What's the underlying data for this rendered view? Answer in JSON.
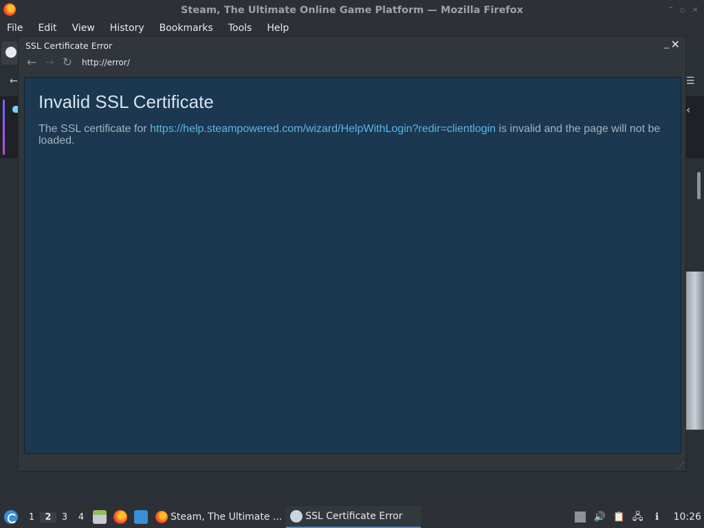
{
  "firefox": {
    "window_title": "Steam, The Ultimate Online Game Platform — Mozilla Firefox",
    "menu": [
      {
        "label": "File"
      },
      {
        "label": "Edit"
      },
      {
        "label": "View"
      },
      {
        "label": "History"
      },
      {
        "label": "Bookmarks"
      },
      {
        "label": "Tools"
      },
      {
        "label": "Help"
      }
    ],
    "window_controls": {
      "minimize": "‾",
      "maximize": "◇",
      "close": "✕"
    }
  },
  "dialog": {
    "title": "SSL Certificate Error",
    "minimize": "_",
    "close": "✕",
    "nav": {
      "back": "←",
      "forward": "→",
      "reload": "↻"
    },
    "url": "http://error/",
    "heading": "Invalid SSL Certificate",
    "message_prefix": "The SSL certificate for ",
    "message_link": "https://help.steampowered.com/wizard/HelpWithLogin?redir=clientlogin",
    "message_suffix": " is invalid and the page will not be loaded."
  },
  "taskbar": {
    "desktops": [
      "1",
      "2",
      "3",
      "4"
    ],
    "active_desktop": "2",
    "tasks": [
      {
        "label": "Steam, The Ultimate ...",
        "icon": "firefox-icon"
      },
      {
        "label": "SSL Certificate Error",
        "icon": "steam-icon"
      }
    ],
    "clock": "10:26"
  },
  "colors": {
    "content_bg": "#1b3850",
    "link": "#5cb6e8",
    "accent": "#3a8fd6"
  }
}
